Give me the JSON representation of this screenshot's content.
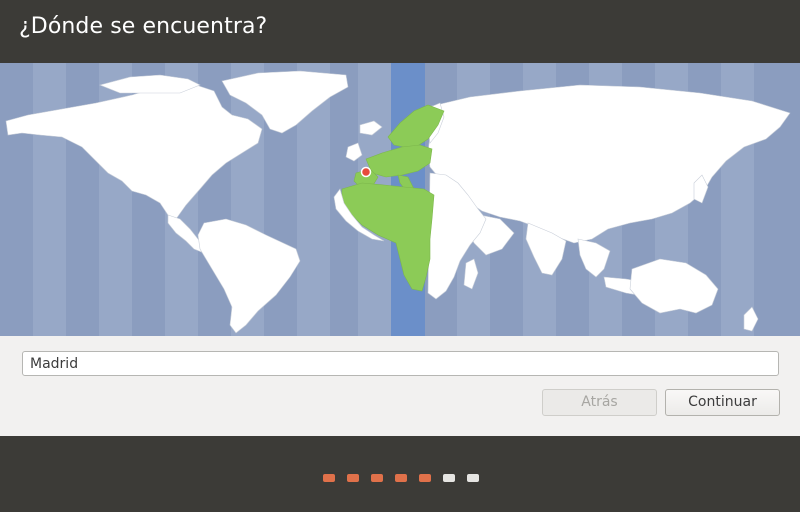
{
  "window": {
    "title": "¿Dónde se encuentra?"
  },
  "map": {
    "selected_marker": "location-pin-icon",
    "colors": {
      "ocean": "#8b9dbf",
      "land": "#ffffff",
      "selected_timezone_land": "#8ccb57",
      "selected_timezone_band": "#6b8fc9",
      "marker": "#e74c3c"
    }
  },
  "location": {
    "value": "Madrid"
  },
  "buttons": {
    "back_label": "Atrás",
    "continue_label": "Continuar"
  },
  "progress": {
    "total_steps": 7,
    "completed_steps": 5,
    "accent_color": "#e0714a"
  }
}
